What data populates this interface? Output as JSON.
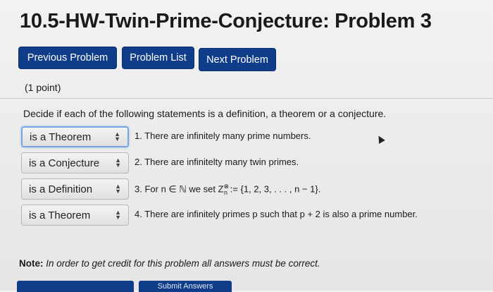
{
  "title": "10.5-HW-Twin-Prime-Conjecture: Problem 3",
  "nav": {
    "previous": "Previous Problem",
    "list": "Problem List",
    "next": "Next Problem"
  },
  "points": "(1 point)",
  "instructions": "Decide if each of the following statements is a definition, a theorem or a conjecture.",
  "rows": [
    {
      "selected": "is a Theorem",
      "statement": "1. There are infinitely many prime numbers."
    },
    {
      "selected": "is a Conjecture",
      "statement": "2. There are infinitelty many twin primes."
    },
    {
      "selected": "is a Definition",
      "statement": "3. For n ∈ ℕ we set Z",
      "statement_sup": "⊗",
      "statement_sub": "n",
      "statement_tail": " := {1, 2, 3, . . . , n − 1}."
    },
    {
      "selected": "is a Theorem",
      "statement": "4. There are infinitely primes p such that p + 2 is also a prime number."
    }
  ],
  "note": {
    "label": "Note:",
    "text": "In order to get credit for this problem all answers must be correct."
  },
  "submit_label": "Submit Answers",
  "colors": {
    "button_blue": "#0f3d89",
    "focus_ring": "#7aa4dd"
  }
}
